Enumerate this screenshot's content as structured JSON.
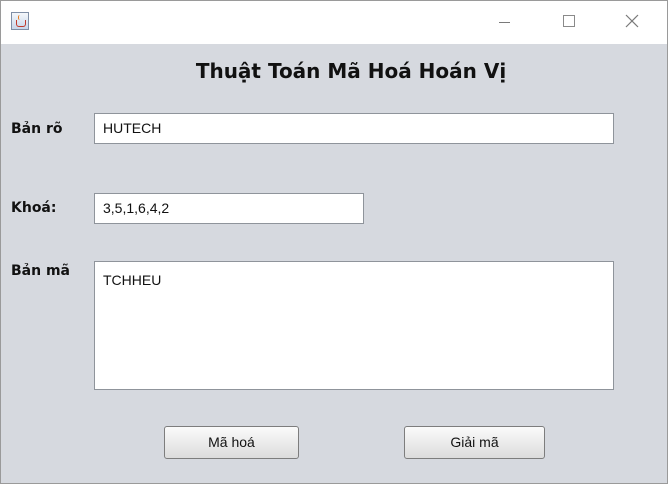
{
  "window": {
    "title": "Thuật Toán Mã Hoá Hoán Vị",
    "app_icon": "java-cup-icon",
    "controls": {
      "minimize": "minimize-icon",
      "maximize": "maximize-icon",
      "close": "close-icon"
    }
  },
  "form": {
    "plaintext_label": "Bản rõ",
    "plaintext_value": "HUTECH",
    "key_label": "Khoá:",
    "key_value": "3,5,1,6,4,2",
    "ciphertext_label": "Bản mã",
    "ciphertext_value": "TCHHEU"
  },
  "buttons": {
    "encrypt": "Mã hoá",
    "decrypt": "Giải mã"
  },
  "colors": {
    "window_bg": "#d6d9df",
    "titlebar_bg": "#ffffff",
    "field_bg": "#ffffff"
  }
}
